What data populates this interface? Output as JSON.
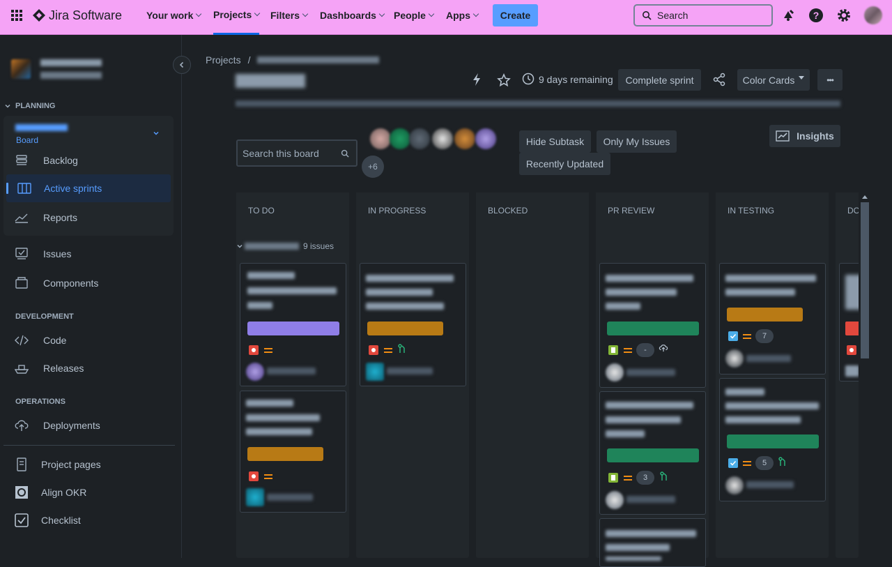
{
  "topnav": {
    "logo_text": "Jira Software",
    "items": [
      "Your work",
      "Projects",
      "Filters",
      "Dashboards",
      "People",
      "Apps"
    ],
    "create_label": "Create",
    "search_placeholder": "Search"
  },
  "sidebar": {
    "project_name": "",
    "planning_label": "PLANNING",
    "board_label": "Board",
    "planning_items": [
      "Backlog",
      "Active sprints",
      "Reports"
    ],
    "items": [
      "Issues",
      "Components"
    ],
    "development_label": "DEVELOPMENT",
    "dev_items": [
      "Code",
      "Releases"
    ],
    "operations_label": "OPERATIONS",
    "ops_items": [
      "Deployments"
    ],
    "bottom_items": [
      "Project pages",
      "Align OKR",
      "Checklist"
    ]
  },
  "header": {
    "breadcrumb_root": "Projects",
    "breadcrumb_sep": "/",
    "days_remaining": "9 days remaining",
    "complete_sprint": "Complete sprint",
    "color_cards": "Color Cards",
    "more": "•••"
  },
  "filters": {
    "search_placeholder": "Search this board",
    "avatar_more": "+6",
    "hide_subtask": "Hide Subtask",
    "only_my_issues": "Only My Issues",
    "recently_updated": "Recently Updated",
    "insights": "Insights"
  },
  "board": {
    "columns": [
      "TO DO",
      "IN PROGRESS",
      "BLOCKED",
      "PR REVIEW",
      "IN TESTING",
      "DO"
    ],
    "swimlane_count": "9 issues",
    "badges": {
      "pr1": "-",
      "pr2": "3",
      "test1": "7",
      "test2": "5"
    }
  },
  "colors": {
    "nav_bg": "#f5a3f6",
    "create_bg": "#579dff",
    "link": "#579dff",
    "board_bg": "#1d2125"
  }
}
